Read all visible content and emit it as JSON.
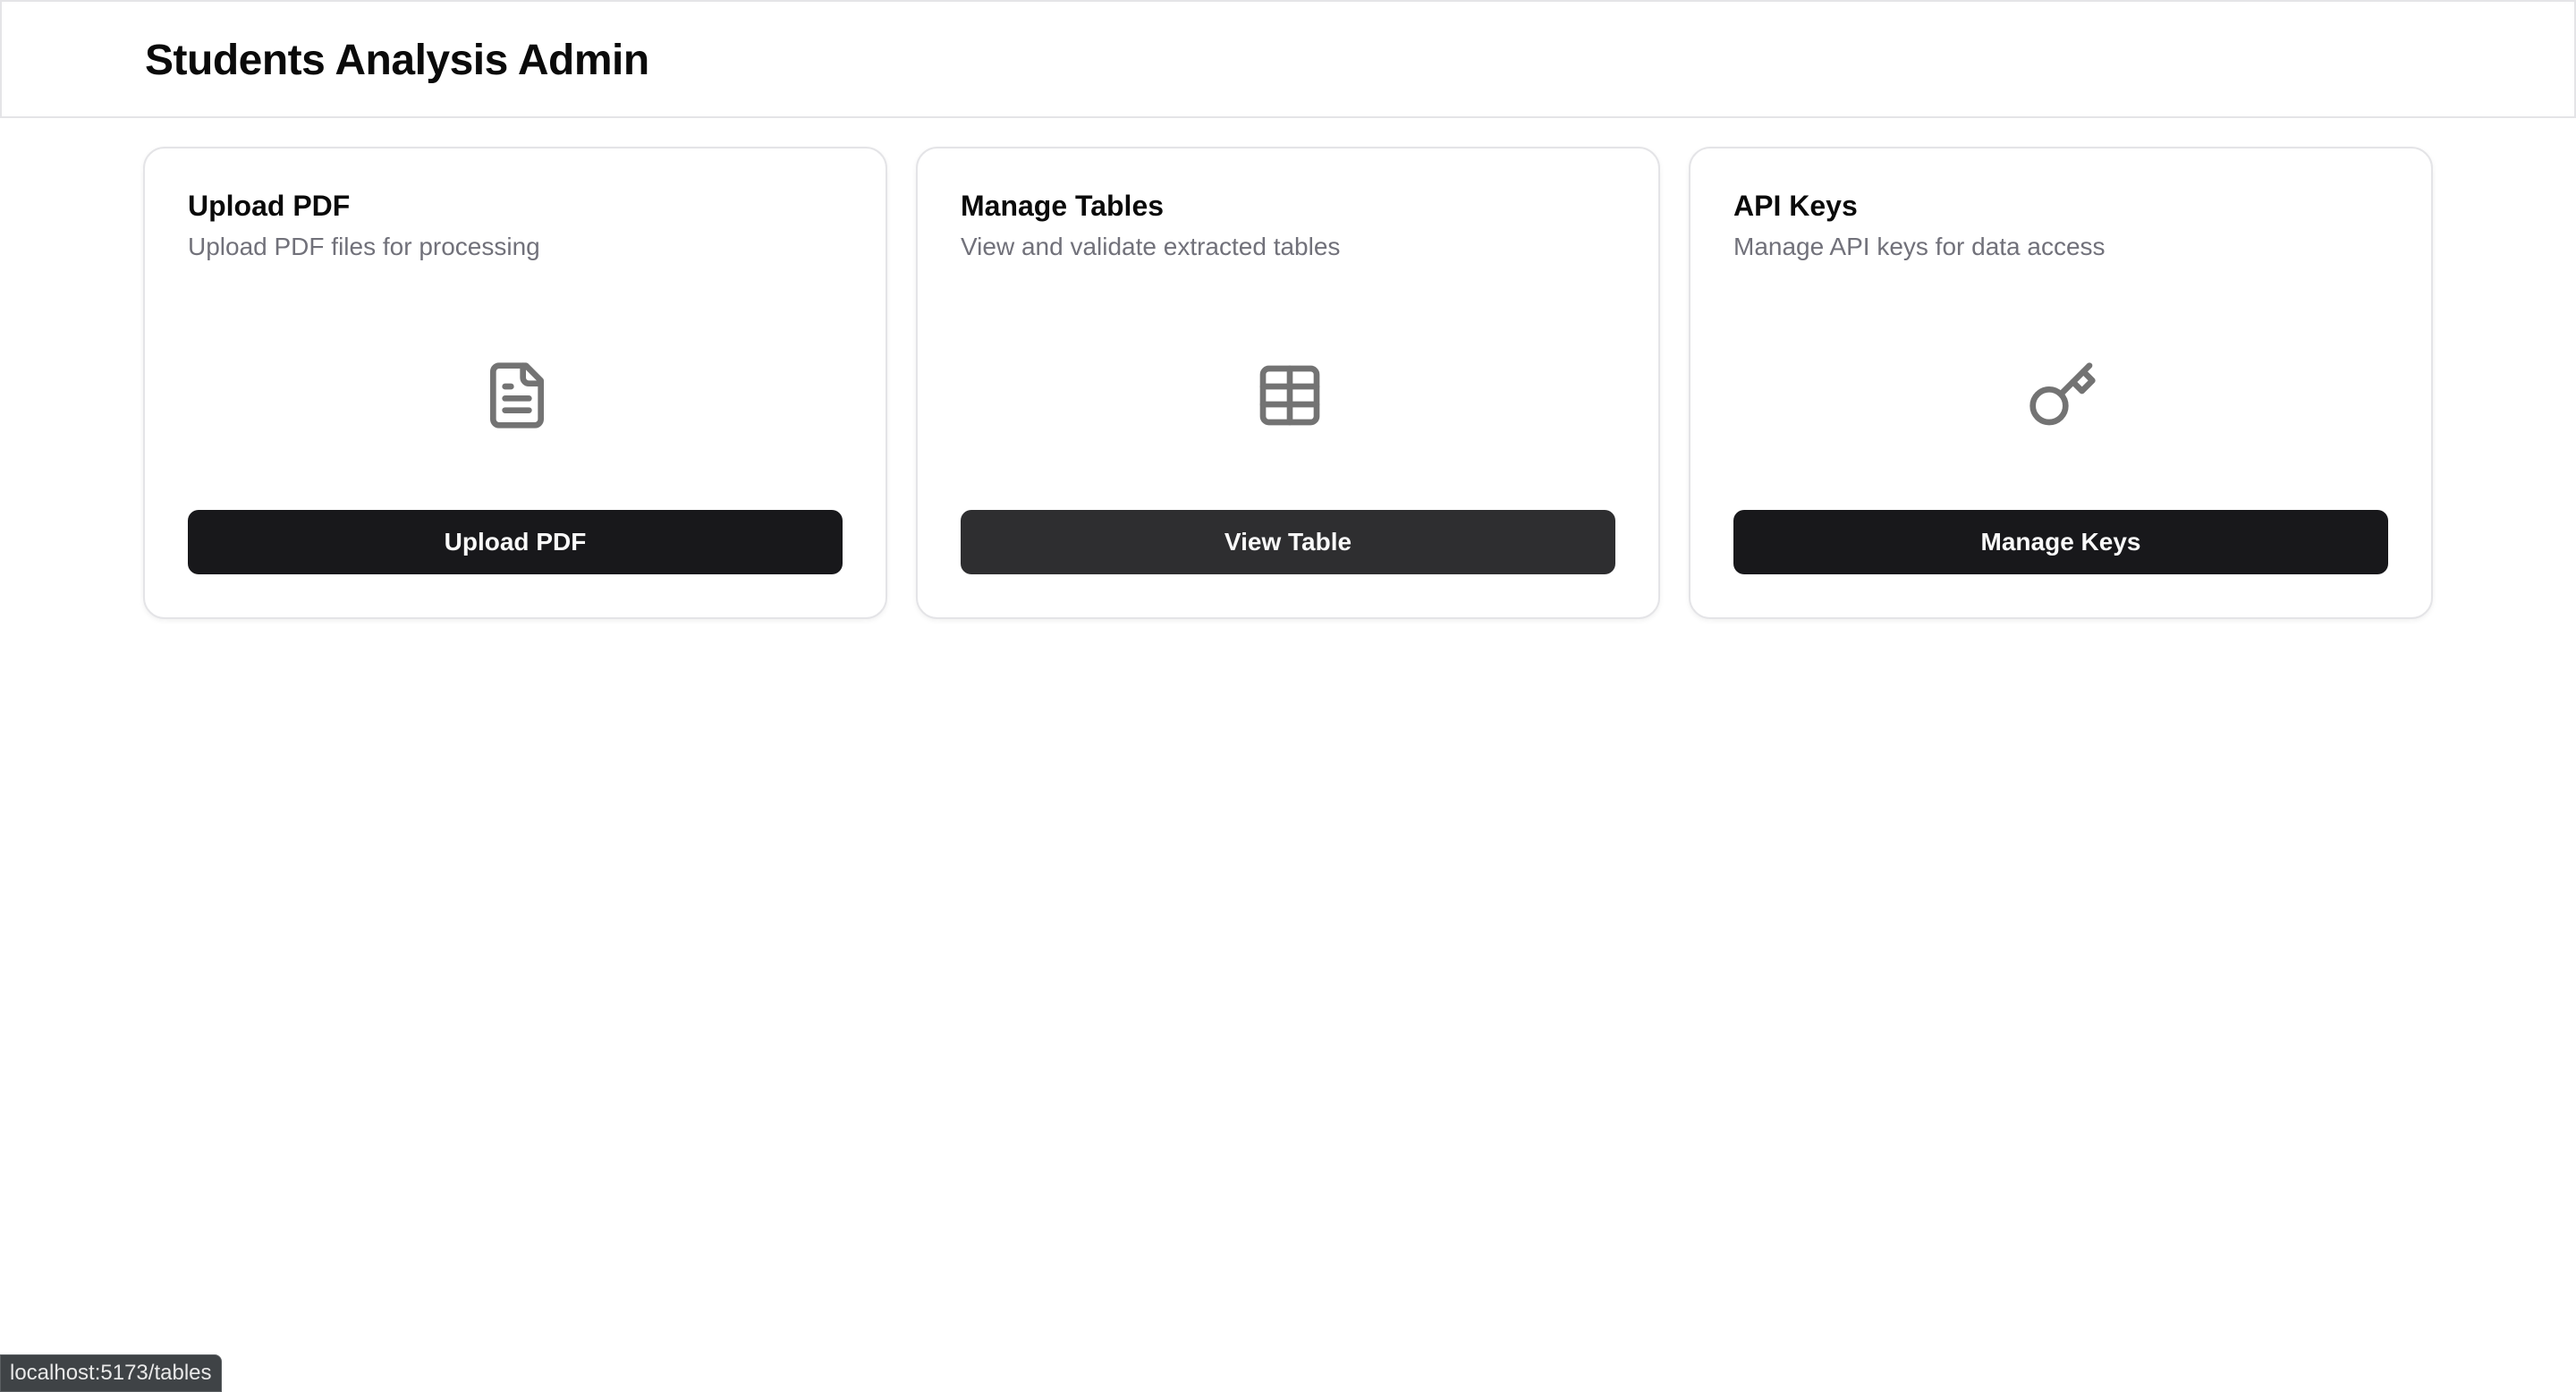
{
  "header": {
    "title": "Students Analysis Admin"
  },
  "cards": [
    {
      "title": "Upload PDF",
      "description": "Upload PDF files for processing",
      "icon": "file-text-icon",
      "button_label": "Upload PDF"
    },
    {
      "title": "Manage Tables",
      "description": "View and validate extracted tables",
      "icon": "table-icon",
      "button_label": "View Table"
    },
    {
      "title": "API Keys",
      "description": "Manage API keys for data access",
      "icon": "key-icon",
      "button_label": "Manage Keys"
    }
  ],
  "status_bar": {
    "url": "localhost:5173/tables"
  },
  "colors": {
    "button_bg": "#18181b",
    "button_hover_bg": "#2e2e30",
    "icon": "#737373",
    "muted_text": "#71717a",
    "border": "#e4e4e7"
  }
}
